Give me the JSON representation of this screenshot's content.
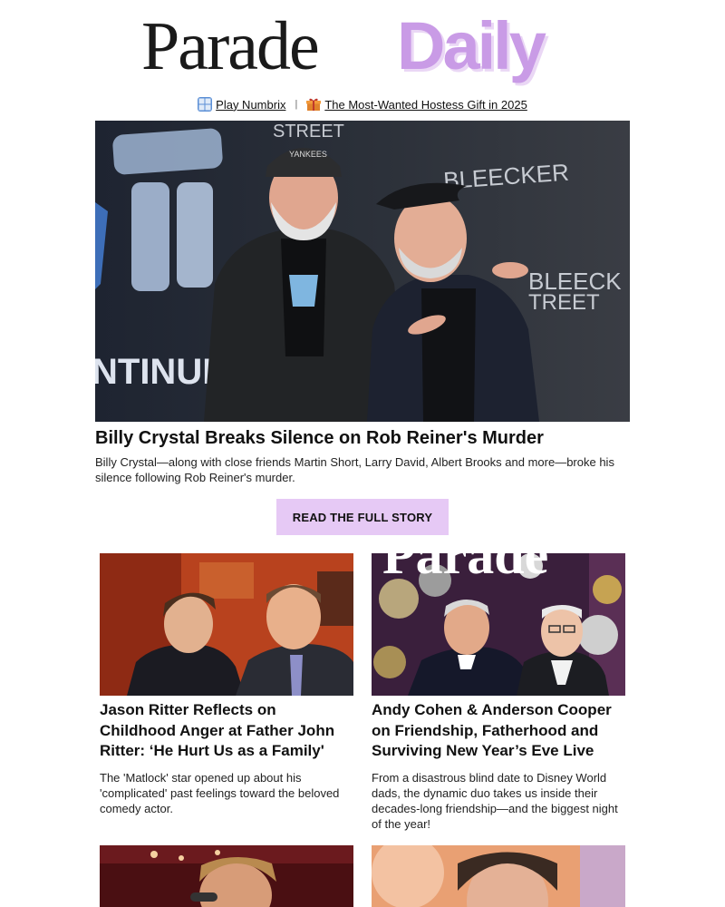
{
  "brand": {
    "word1": "Parade",
    "word2": "Daily",
    "accent": "#c99be6"
  },
  "promo": {
    "numbrix_label": "Play Numbrix",
    "numbrix_icon": "numbers-icon",
    "separator": "|",
    "gift_label": "The Most-Wanted Hostess Gift in 2025",
    "gift_icon": "gift-icon"
  },
  "hero": {
    "image_label": "Billy Crystal and Rob Reiner at premiere",
    "backdrop_text_1": "STREET",
    "backdrop_text_2": "BLEECKER",
    "backdrop_text_3": "BLEECK",
    "backdrop_text_4": "TREET",
    "backdrop_text_5": "NTINUES",
    "title": "Billy Crystal Breaks Silence on Rob Reiner's Murder",
    "description": "Billy Crystal—along with close friends Martin Short, Larry David, Albert Brooks and more—broke his silence following Rob Reiner's murder.",
    "cta_label": "READ THE FULL STORY"
  },
  "cards": [
    {
      "title": "Jason Ritter Reflects on Childhood Anger at Father John Ritter: ‘He Hurt Us as a Family'",
      "description": "The 'Matlock' star opened up about his 'complicated' past feelings toward the beloved comedy actor."
    },
    {
      "title": "Andy Cohen & Anderson Cooper on Friendship, Fatherhood and Surviving New Year’s Eve Live",
      "description": "From a disastrous blind date to Disney World dads, the dynamic duo takes us inside their decades-long friendship—and the biggest night of the year!",
      "cover_text": "Parade"
    }
  ],
  "colors": {
    "cta_bg": "#e6c9f5",
    "text": "#111111"
  }
}
